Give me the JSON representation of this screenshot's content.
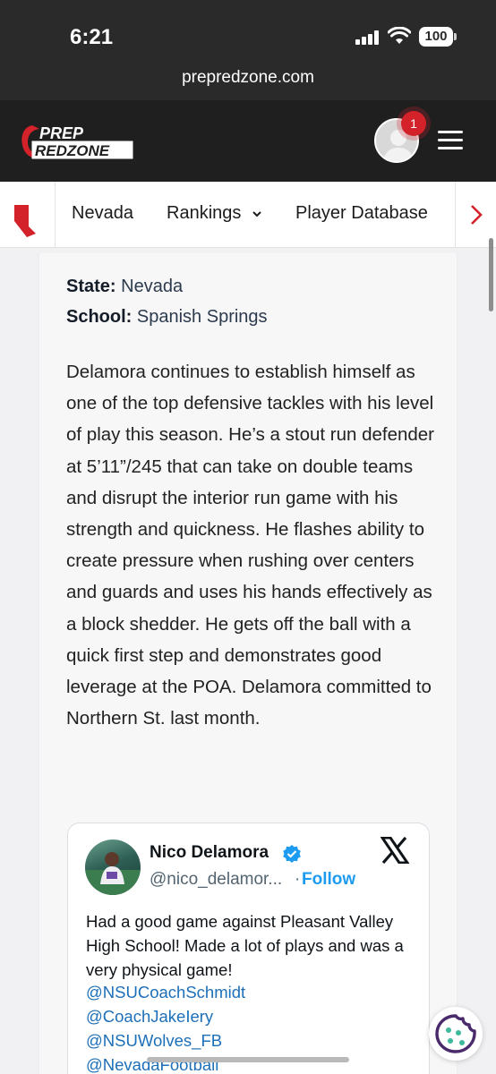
{
  "status_bar": {
    "time": "6:21",
    "battery": "100"
  },
  "browser": {
    "url": "prepredzone.com"
  },
  "header": {
    "logo_top": "PREP",
    "logo_bottom": "REDZONE",
    "notification_count": "1",
    "accent_color": "#d3222a"
  },
  "nav": {
    "items": [
      {
        "label": "Nevada"
      },
      {
        "label": "Rankings"
      },
      {
        "label": "Player Database"
      }
    ]
  },
  "article": {
    "state_label": "State:",
    "state_value": "Nevada",
    "school_label": "School:",
    "school_value": "Spanish Springs",
    "body": "Delamora continues to establish himself as one of the top defensive tackles with his level of play this season. He’s a stout run defender at 5’11”/245 that can take on double teams and disrupt the interior run game with his strength and quickness. He flashes ability to create pressure when rushing over centers and guards and uses his hands effectively as a block shedder. He gets off the ball with a quick first step and demonstrates good leverage at the POA. Delamora committed to Northern St. last month."
  },
  "tweet": {
    "name": "Nico Delamora",
    "handle": "@nico_delamor...",
    "separator": "·",
    "follow_label": "Follow",
    "text": "Had a good game against Pleasant Valley High School! Made a lot of plays and was a very physical game!",
    "mentions": [
      "@NSUCoachSchmidt",
      "@CoachJakeIery",
      "@NSUWolves_FB",
      "@NevadaFootball"
    ]
  }
}
